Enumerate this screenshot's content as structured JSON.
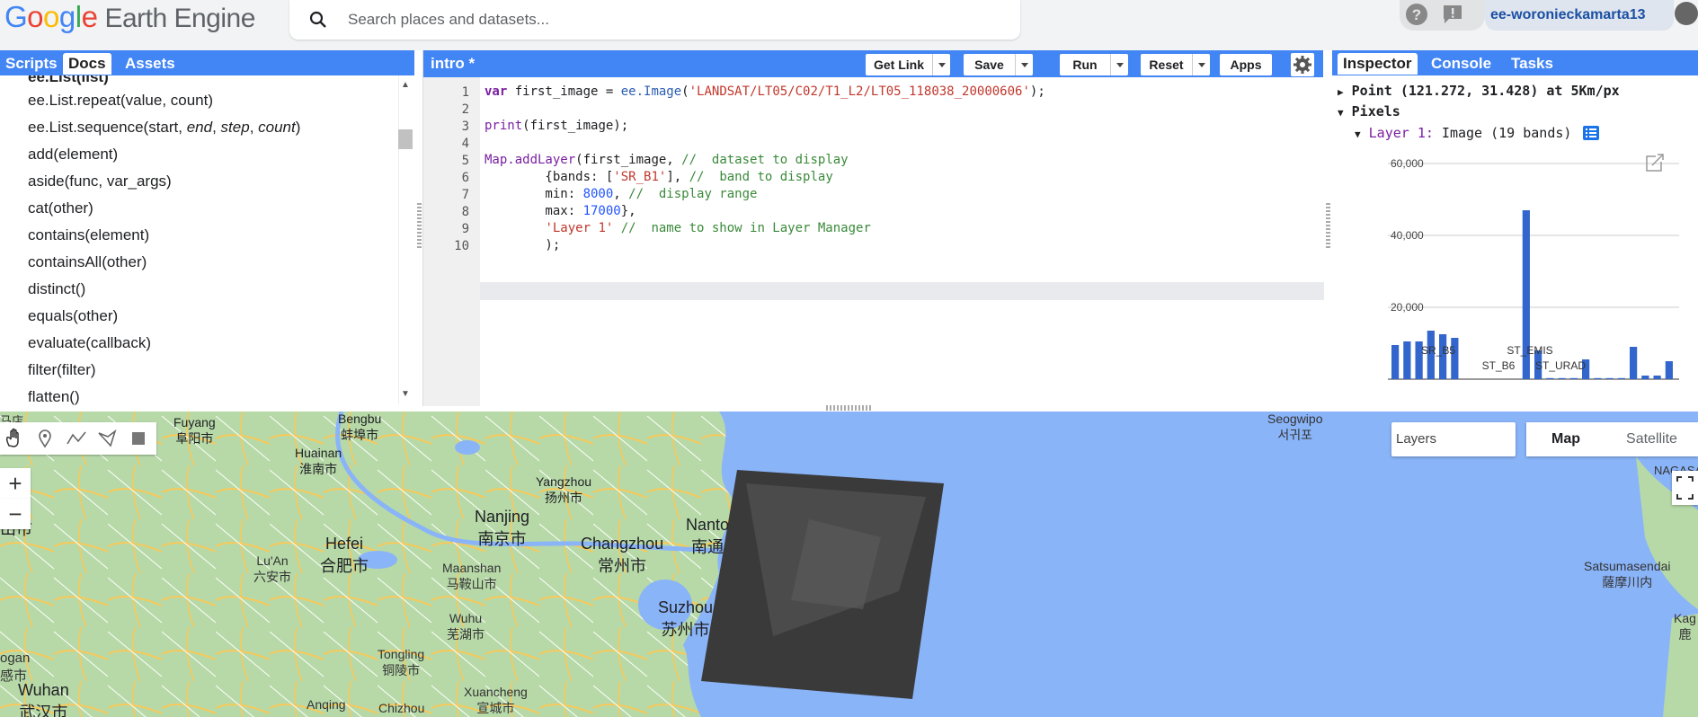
{
  "header": {
    "logo": {
      "google": [
        "G",
        "o",
        "o",
        "g",
        "l",
        "e"
      ],
      "product": "Earth Engine"
    },
    "search_placeholder": "Search places and datasets...",
    "user": "ee-woronieckamarta13"
  },
  "left_panel": {
    "tabs": [
      "Scripts",
      "Docs",
      "Assets"
    ],
    "active_tab": "Docs",
    "doc_items": [
      "ee.List(list)",
      "ee.List.repeat(value, count)",
      "ee.List.sequence(start, end, step, count)",
      "add(element)",
      "aside(func, var_args)",
      "cat(other)",
      "contains(element)",
      "containsAll(other)",
      "distinct()",
      "equals(other)",
      "evaluate(callback)",
      "filter(filter)",
      "flatten()"
    ]
  },
  "editor": {
    "title": "intro *",
    "buttons": {
      "get_link": "Get Link",
      "save": "Save",
      "run": "Run",
      "reset": "Reset",
      "apps": "Apps"
    },
    "line_numbers": [
      "1",
      "2",
      "3",
      "4",
      "5",
      "6",
      "7",
      "8",
      "9",
      "10"
    ],
    "code": {
      "l1_var": "var ",
      "l1_name": "first_image = ",
      "l1_fn": "ee.Image",
      "l1_open": "(",
      "l1_str": "'LANDSAT/LT05/C02/T1_L2/LT05_118038_20000606'",
      "l1_close": ");",
      "l3_fn": "print",
      "l3_rest": "(first_image);",
      "l5_fn": "Map.addLayer",
      "l5_rest": "(first_image, ",
      "l5_cm": "//  dataset to display",
      "l6_a": "        {bands: [",
      "l6_str": "'SR_B1'",
      "l6_b": "], ",
      "l6_cm": "//  band to display",
      "l7_a": "        min: ",
      "l7_num": "8000",
      "l7_b": ", ",
      "l7_cm": "//  display range",
      "l8_a": "        max: ",
      "l8_num": "17000",
      "l8_b": "},",
      "l9_a": "        ",
      "l9_str": "'Layer 1'",
      "l9_b": " ",
      "l9_cm": "//  name to show in Layer Manager",
      "l10": "        );"
    }
  },
  "inspector": {
    "tabs": [
      "Inspector",
      "Console",
      "Tasks"
    ],
    "active_tab": "Inspector",
    "point": "Point (121.272, 31.428) at 5Km/px",
    "pixels": "Pixels",
    "layer_name": "Layer 1:",
    "layer_desc": " Image (19 bands)"
  },
  "chart_data": {
    "type": "bar",
    "ylim": [
      0,
      60000
    ],
    "y_ticks": [
      "60,000",
      "40,000",
      "20,000"
    ],
    "x_tick_labels": [
      "SR_B5",
      "ST_B6",
      "ST_EMIS",
      "ST_URAD"
    ],
    "values": [
      9500,
      10500,
      10500,
      13500,
      12500,
      11500,
      0,
      0,
      0,
      0,
      0,
      47000,
      8000,
      300,
      300,
      300,
      5500,
      300,
      300,
      300,
      9000,
      1000,
      1000,
      5000
    ],
    "bar_color": "#3366cc"
  },
  "map": {
    "layers_label": "Layers",
    "toggle_map": "Map",
    "toggle_satellite": "Satellite",
    "zoom_in": "+",
    "zoom_out": "−",
    "labels": [
      {
        "name": "Fuyang",
        "local": "阜阳市"
      },
      {
        "name": "Bengbu",
        "local": "蚌埠市"
      },
      {
        "name": "Huainan",
        "local": "淮南市"
      },
      {
        "name": "Yangzhou",
        "local": "扬州市"
      },
      {
        "name": "Nanjing",
        "local": "南京市"
      },
      {
        "name": "Hefei",
        "local": "合肥市"
      },
      {
        "name": "Lu'An",
        "local": "六安市"
      },
      {
        "name": "Maanshan",
        "local": "马鞍山市"
      },
      {
        "name": "Changzhou",
        "local": "常州市"
      },
      {
        "name": "Nanto",
        "local": "南通"
      },
      {
        "name": "Suzhou",
        "local": "苏州市"
      },
      {
        "name": "Wuhu",
        "local": "芜湖市"
      },
      {
        "name": "Tongling",
        "local": "铜陵市"
      },
      {
        "name": "Wuhan",
        "local": "武汉市"
      },
      {
        "name": "Xuancheng",
        "local": "宣城市"
      },
      {
        "name": "Anqing",
        "local": ""
      },
      {
        "name": "Chizhou",
        "local": ""
      },
      {
        "name": "Seogwipo",
        "local": "서귀포"
      },
      {
        "name": "Satsumasendai",
        "local": "薩摩川内"
      },
      {
        "name": "NAGASAK",
        "local": ""
      },
      {
        "name": "ang",
        "local": "山市"
      },
      {
        "name": "ogan",
        "local": "感市"
      },
      {
        "name": "Kag",
        "local": "鹿"
      },
      {
        "name": "马店",
        "local": ""
      }
    ]
  }
}
